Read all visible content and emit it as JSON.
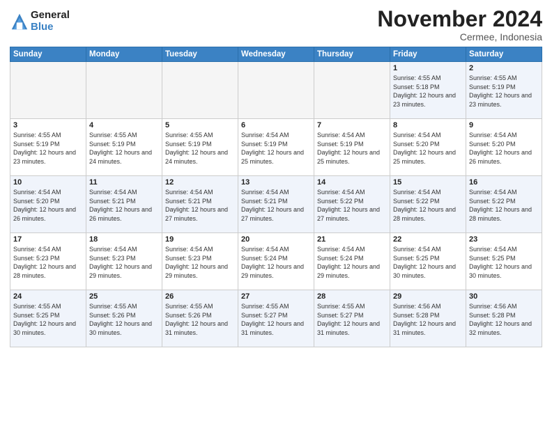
{
  "header": {
    "logo_general": "General",
    "logo_blue": "Blue",
    "month_title": "November 2024",
    "subtitle": "Cermee, Indonesia"
  },
  "days_of_week": [
    "Sunday",
    "Monday",
    "Tuesday",
    "Wednesday",
    "Thursday",
    "Friday",
    "Saturday"
  ],
  "weeks": [
    [
      {
        "day": "",
        "empty": true
      },
      {
        "day": "",
        "empty": true
      },
      {
        "day": "",
        "empty": true
      },
      {
        "day": "",
        "empty": true
      },
      {
        "day": "",
        "empty": true
      },
      {
        "day": "1",
        "info": "Sunrise: 4:55 AM\nSunset: 5:18 PM\nDaylight: 12 hours\nand 23 minutes."
      },
      {
        "day": "2",
        "info": "Sunrise: 4:55 AM\nSunset: 5:19 PM\nDaylight: 12 hours\nand 23 minutes."
      }
    ],
    [
      {
        "day": "3",
        "info": "Sunrise: 4:55 AM\nSunset: 5:19 PM\nDaylight: 12 hours\nand 23 minutes."
      },
      {
        "day": "4",
        "info": "Sunrise: 4:55 AM\nSunset: 5:19 PM\nDaylight: 12 hours\nand 24 minutes."
      },
      {
        "day": "5",
        "info": "Sunrise: 4:55 AM\nSunset: 5:19 PM\nDaylight: 12 hours\nand 24 minutes."
      },
      {
        "day": "6",
        "info": "Sunrise: 4:54 AM\nSunset: 5:19 PM\nDaylight: 12 hours\nand 25 minutes."
      },
      {
        "day": "7",
        "info": "Sunrise: 4:54 AM\nSunset: 5:19 PM\nDaylight: 12 hours\nand 25 minutes."
      },
      {
        "day": "8",
        "info": "Sunrise: 4:54 AM\nSunset: 5:20 PM\nDaylight: 12 hours\nand 25 minutes."
      },
      {
        "day": "9",
        "info": "Sunrise: 4:54 AM\nSunset: 5:20 PM\nDaylight: 12 hours\nand 26 minutes."
      }
    ],
    [
      {
        "day": "10",
        "info": "Sunrise: 4:54 AM\nSunset: 5:20 PM\nDaylight: 12 hours\nand 26 minutes."
      },
      {
        "day": "11",
        "info": "Sunrise: 4:54 AM\nSunset: 5:21 PM\nDaylight: 12 hours\nand 26 minutes."
      },
      {
        "day": "12",
        "info": "Sunrise: 4:54 AM\nSunset: 5:21 PM\nDaylight: 12 hours\nand 27 minutes."
      },
      {
        "day": "13",
        "info": "Sunrise: 4:54 AM\nSunset: 5:21 PM\nDaylight: 12 hours\nand 27 minutes."
      },
      {
        "day": "14",
        "info": "Sunrise: 4:54 AM\nSunset: 5:22 PM\nDaylight: 12 hours\nand 27 minutes."
      },
      {
        "day": "15",
        "info": "Sunrise: 4:54 AM\nSunset: 5:22 PM\nDaylight: 12 hours\nand 28 minutes."
      },
      {
        "day": "16",
        "info": "Sunrise: 4:54 AM\nSunset: 5:22 PM\nDaylight: 12 hours\nand 28 minutes."
      }
    ],
    [
      {
        "day": "17",
        "info": "Sunrise: 4:54 AM\nSunset: 5:23 PM\nDaylight: 12 hours\nand 28 minutes."
      },
      {
        "day": "18",
        "info": "Sunrise: 4:54 AM\nSunset: 5:23 PM\nDaylight: 12 hours\nand 29 minutes."
      },
      {
        "day": "19",
        "info": "Sunrise: 4:54 AM\nSunset: 5:23 PM\nDaylight: 12 hours\nand 29 minutes."
      },
      {
        "day": "20",
        "info": "Sunrise: 4:54 AM\nSunset: 5:24 PM\nDaylight: 12 hours\nand 29 minutes."
      },
      {
        "day": "21",
        "info": "Sunrise: 4:54 AM\nSunset: 5:24 PM\nDaylight: 12 hours\nand 29 minutes."
      },
      {
        "day": "22",
        "info": "Sunrise: 4:54 AM\nSunset: 5:25 PM\nDaylight: 12 hours\nand 30 minutes."
      },
      {
        "day": "23",
        "info": "Sunrise: 4:54 AM\nSunset: 5:25 PM\nDaylight: 12 hours\nand 30 minutes."
      }
    ],
    [
      {
        "day": "24",
        "info": "Sunrise: 4:55 AM\nSunset: 5:25 PM\nDaylight: 12 hours\nand 30 minutes."
      },
      {
        "day": "25",
        "info": "Sunrise: 4:55 AM\nSunset: 5:26 PM\nDaylight: 12 hours\nand 30 minutes."
      },
      {
        "day": "26",
        "info": "Sunrise: 4:55 AM\nSunset: 5:26 PM\nDaylight: 12 hours\nand 31 minutes."
      },
      {
        "day": "27",
        "info": "Sunrise: 4:55 AM\nSunset: 5:27 PM\nDaylight: 12 hours\nand 31 minutes."
      },
      {
        "day": "28",
        "info": "Sunrise: 4:55 AM\nSunset: 5:27 PM\nDaylight: 12 hours\nand 31 minutes."
      },
      {
        "day": "29",
        "info": "Sunrise: 4:56 AM\nSunset: 5:28 PM\nDaylight: 12 hours\nand 31 minutes."
      },
      {
        "day": "30",
        "info": "Sunrise: 4:56 AM\nSunset: 5:28 PM\nDaylight: 12 hours\nand 32 minutes."
      }
    ]
  ]
}
